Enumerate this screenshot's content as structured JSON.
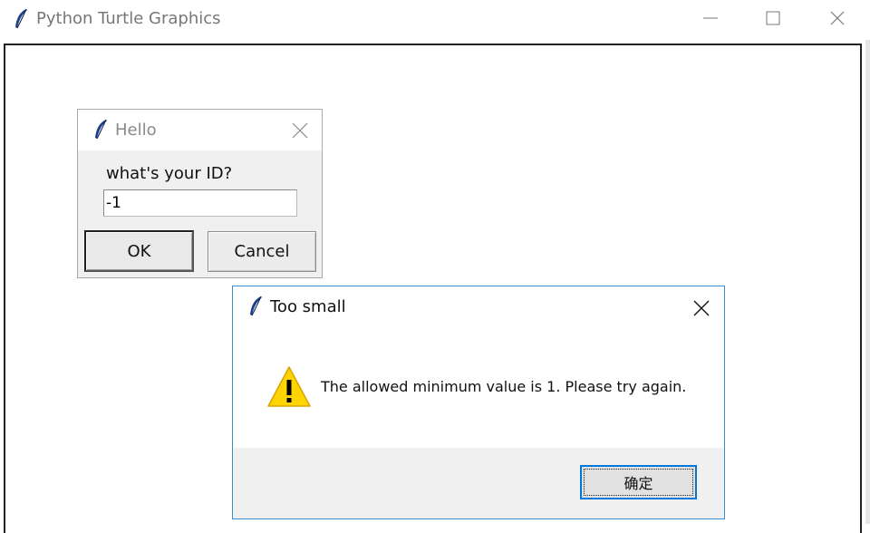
{
  "main_window": {
    "title": "Python Turtle Graphics",
    "icon": "feather-icon",
    "controls": [
      "minimize-icon",
      "maximize-icon",
      "close-icon"
    ]
  },
  "hello_dialog": {
    "title": "Hello",
    "icon": "feather-icon",
    "prompt": "what's your ID?",
    "input_value": "-1",
    "ok_label": "OK",
    "cancel_label": "Cancel"
  },
  "error_dialog": {
    "title": "Too small",
    "icon": "feather-icon",
    "message_icon": "warning-icon",
    "message": "The allowed minimum value is 1. Please try again.",
    "ok_label": "确定",
    "accent_color": "#0078d7"
  }
}
